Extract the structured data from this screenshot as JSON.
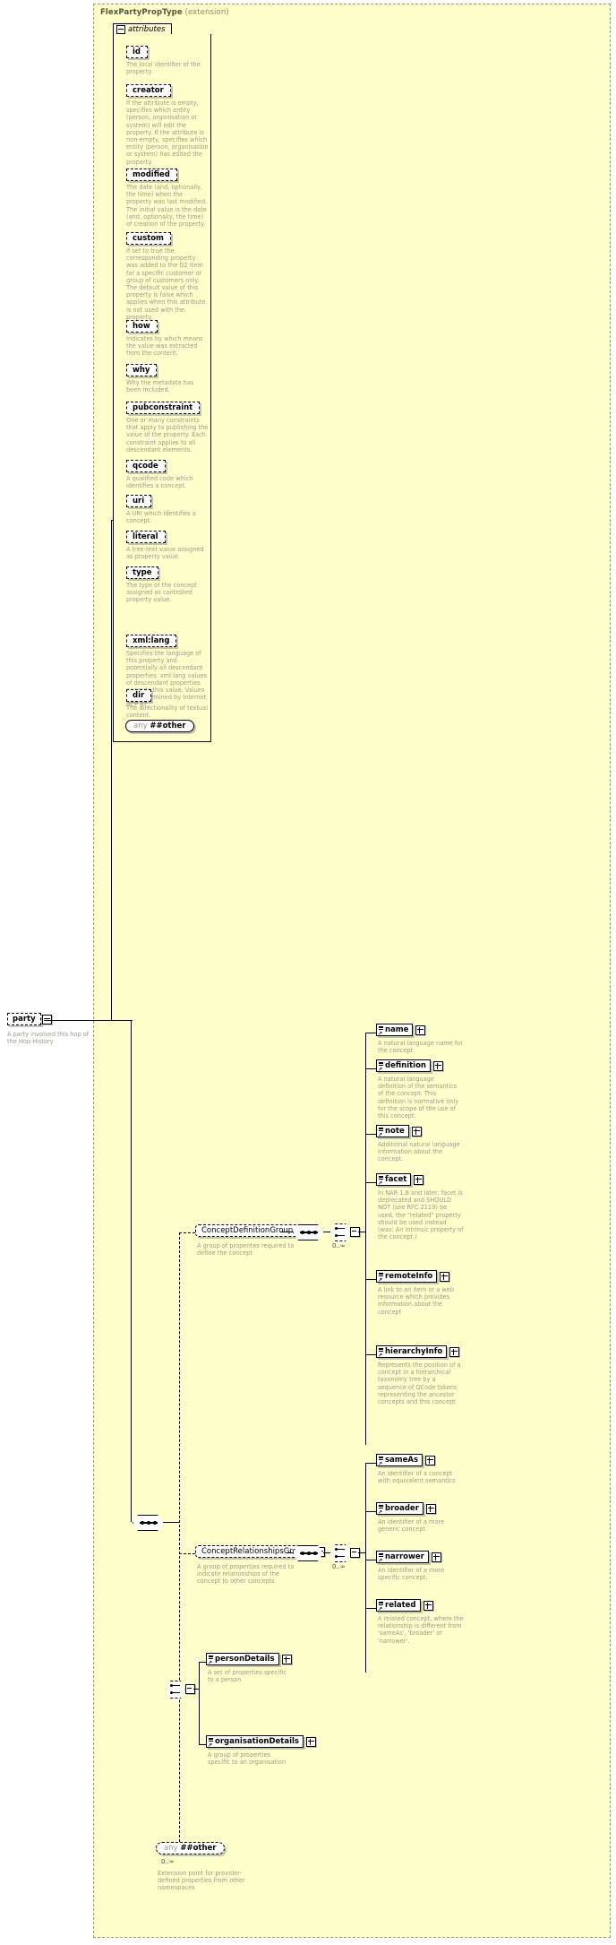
{
  "diagram": {
    "type": "xsd-schema-diagram",
    "extension_title_name": "FlexPartyPropType",
    "extension_title_suffix": "(extension)",
    "attributes_label": "attributes",
    "any_other": {
      "any": "any",
      "other": "##other"
    },
    "colors": {
      "background": "#ffffcc",
      "border": "#000000",
      "desc_text": "#9a9a8a",
      "title_text": "#6f6f4a"
    }
  },
  "attributes": [
    {
      "name": "id",
      "desc": "The local identifier of the property."
    },
    {
      "name": "creator",
      "desc": "If the attribute is empty, specifies which entity (person, organisation or system) will edit the property. If the attribute is non-empty, specifies which entity (person, organisation or system) has edited the property."
    },
    {
      "name": "modified",
      "desc": "The date (and, optionally, the time) when the property was last modified. The initial value is the date (and, optionally, the time) of creation of the property."
    },
    {
      "name": "custom",
      "desc": "If set to true the corresponding property was added to the G2 Item for a specific customer or group of customers only. The default value of this property is false which applies when this attribute is not used with the property."
    },
    {
      "name": "how",
      "desc": "Indicates by which means the value was extracted from the content."
    },
    {
      "name": "why",
      "desc": "Why the metadata has been included."
    },
    {
      "name": "pubconstraint",
      "desc": "One or many constraints that apply to publishing the value of the property. Each constraint applies to all descendant elements."
    },
    {
      "name": "qcode",
      "desc": "A qualified code which identifies a concept."
    },
    {
      "name": "uri",
      "desc": "A URI which identifies a concept."
    },
    {
      "name": "literal",
      "desc": "A free-text value assigned as property value."
    },
    {
      "name": "type",
      "desc": "The type of the concept assigned as controlled property value."
    },
    {
      "name": "xml:lang",
      "desc": "Specifies the language of this property and potentially all descendant properties. xml:lang values of descendant properties override this value. Values are determined by Internet BCP 47."
    },
    {
      "name": "dir",
      "desc": "The directionality of textual content."
    }
  ],
  "root_element": {
    "name": "party",
    "desc": "A party involved this hop of the Hop History"
  },
  "groups": [
    {
      "name": "ConceptDefinitionGroup",
      "desc": "A group of properites required to define the concept",
      "cardinality": "0..∞",
      "children": [
        {
          "name": "name",
          "desc": "A natural language name for the concept."
        },
        {
          "name": "definition",
          "desc": "A natural language definition of the semantics of the concept. This definition is normative only for the scope of the use of this concept."
        },
        {
          "name": "note",
          "desc": "Additional natural language information about the concept."
        },
        {
          "name": "facet",
          "desc": "In NAR 1.8 and later, facet is deprecated and SHOULD NOT (see RFC 2119) be used, the \"related\" property should be used instead (was: An intrinsic property of the concept.)"
        },
        {
          "name": "remoteInfo",
          "desc": "A link to an item or a web resource which provides information about the concept"
        },
        {
          "name": "hierarchyInfo",
          "desc": "Represents the position of a concept in a hierarchical taxonomy tree by a sequence of QCode tokens representing the ancestor concepts and this concept"
        }
      ]
    },
    {
      "name": "ConceptRelationshipsGroup",
      "desc": "A group of properties required to indicate relationships of the concept to other concepts",
      "cardinality": "0..∞",
      "children": [
        {
          "name": "sameAs",
          "desc": "An identifier of a concept with equivalent semantics"
        },
        {
          "name": "broader",
          "desc": "An identifier of a more generic concept."
        },
        {
          "name": "narrower",
          "desc": "An identifier of a more specific concept."
        },
        {
          "name": "related",
          "desc": "A related concept, where the relationship is different from 'sameAs', 'broader' or 'narrower'."
        }
      ]
    }
  ],
  "detail_choice": [
    {
      "name": "personDetails",
      "desc": "A set of properties specific to a person"
    },
    {
      "name": "organisationDetails",
      "desc": "A group of properties specific to an organisation"
    }
  ],
  "any_extension": {
    "any": "any",
    "other": "##other",
    "cardinality": "0..∞",
    "desc": "Extension point for provider-defined properties from other namespaces"
  }
}
